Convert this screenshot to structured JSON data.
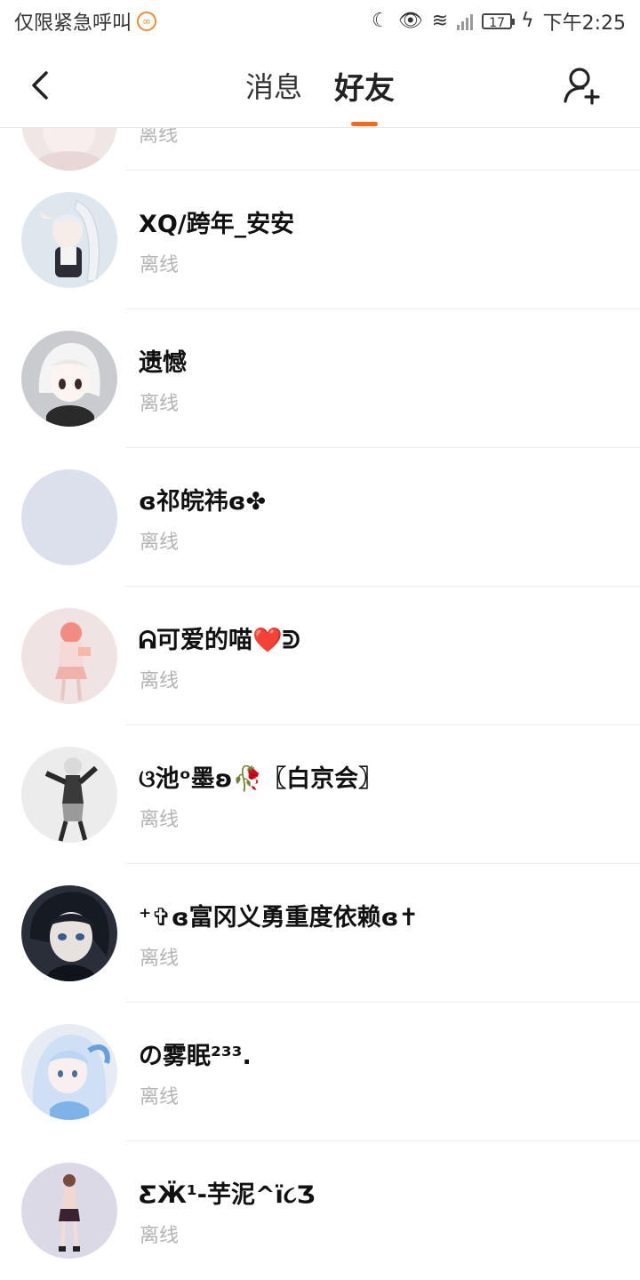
{
  "status_bar": {
    "carrier": "仅限紧急呼叫",
    "battery": "17",
    "time": "下午2:25"
  },
  "header": {
    "tabs": [
      {
        "label": "消息",
        "active": false
      },
      {
        "label": "好友",
        "active": true
      }
    ],
    "accent_color": "#f26b1d"
  },
  "friends": [
    {
      "name": "XQ/跨年_安安",
      "status": "离线",
      "avatar_bg": "#dfe7ee"
    },
    {
      "name": "遗憾",
      "status": "离线",
      "avatar_bg": "#c9cbcf"
    },
    {
      "name": "ɞ祁皖祎ɞ✤",
      "status": "离线",
      "avatar_bg": "#dcdfec"
    },
    {
      "name": "ᕱ可爱的喵❤️ᕲ",
      "status": "离线",
      "avatar_bg": "#efe3e3"
    },
    {
      "name": "ଓ池ᵒ墨ʚ🥀〖白京会〗",
      "status": "离线",
      "avatar_bg": "#ececec"
    },
    {
      "name": "⁺✞ɞ富冈义勇重度依赖ɞ✝",
      "status": "离线",
      "avatar_bg": "#2a2e38"
    },
    {
      "name": "の雾眠²³³.",
      "status": "离线",
      "avatar_bg": "#e7ecf3"
    },
    {
      "name": "ƸӜ¹-芋泥^ï૮Ʒ",
      "status": "离线",
      "avatar_bg": "#dcd9e6"
    }
  ],
  "partial_row": {
    "status": "离线"
  }
}
